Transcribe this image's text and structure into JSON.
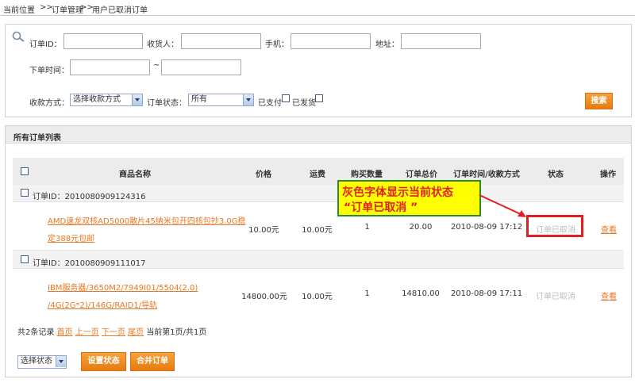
{
  "breadcrumb": {
    "home": "当前位置",
    "sep1": ">>",
    "level1": "订单管理",
    "sep2": ">>",
    "level2": "用户已取消订单"
  },
  "search": {
    "order_id_label": "订单ID：",
    "receiver_label": "收货人：",
    "phone_label": "手机：",
    "address_label": "地址：",
    "order_time_label": "下单时间：",
    "time_sep": "~",
    "payment_label": "收款方式：",
    "payment_value": "选择收款方式",
    "status_label": "订单状态：",
    "status_value": "所有",
    "paid_label": "已支付",
    "shipped_label": "已发货",
    "search_button": "搜索"
  },
  "list": {
    "title": "所有订单列表",
    "columns": [
      "商品名称",
      "价格",
      "运费",
      "购买数量",
      "订单总价",
      "订单时间/收款方式",
      "状态",
      "操作"
    ],
    "orders": [
      {
        "order_id_label": "订单ID：2010080909124316",
        "product_line1": "AMD速龙双核AD5000散片45纳米包开四核包抄3.0G稳",
        "product_line2": "定388元包邮",
        "price": "10.00元",
        "shipping": "10.00元",
        "qty": "1",
        "total": "20.00",
        "time": "2010-08-09 17:12",
        "status": "订单已取消",
        "action": "查看"
      },
      {
        "order_id_label": "订单ID：2010080909111017",
        "product_line1": "IBM服务器/3650M2/7949I01/5504(2.0)",
        "product_line2": "/4G(2G*2)/146G/RAID1/导轨",
        "price": "14800.00元",
        "shipping": "10.00元",
        "qty": "1",
        "total": "14810.00",
        "time": "2010-08-09 17:11",
        "status": "订单已取消",
        "action": "查看"
      }
    ]
  },
  "pagination": {
    "count_text": "共2条记录",
    "first": "首页",
    "prev": "上一页",
    "next": "下一页",
    "last": "尾页",
    "current": "当前第1页/共1页"
  },
  "footer": {
    "status_select": "选择状态",
    "set_status_button": "设置状态",
    "merge_button": "合并订单"
  },
  "annotation": {
    "line1": "灰色字体显示当前状态",
    "line2": "“订单已取消 ”"
  },
  "colors": {
    "accent_orange": "#f08c1e",
    "link": "#e87722",
    "callout_bg": "#ffff00",
    "callout_border": "#2b8a2b",
    "highlight_red": "#e02020"
  }
}
